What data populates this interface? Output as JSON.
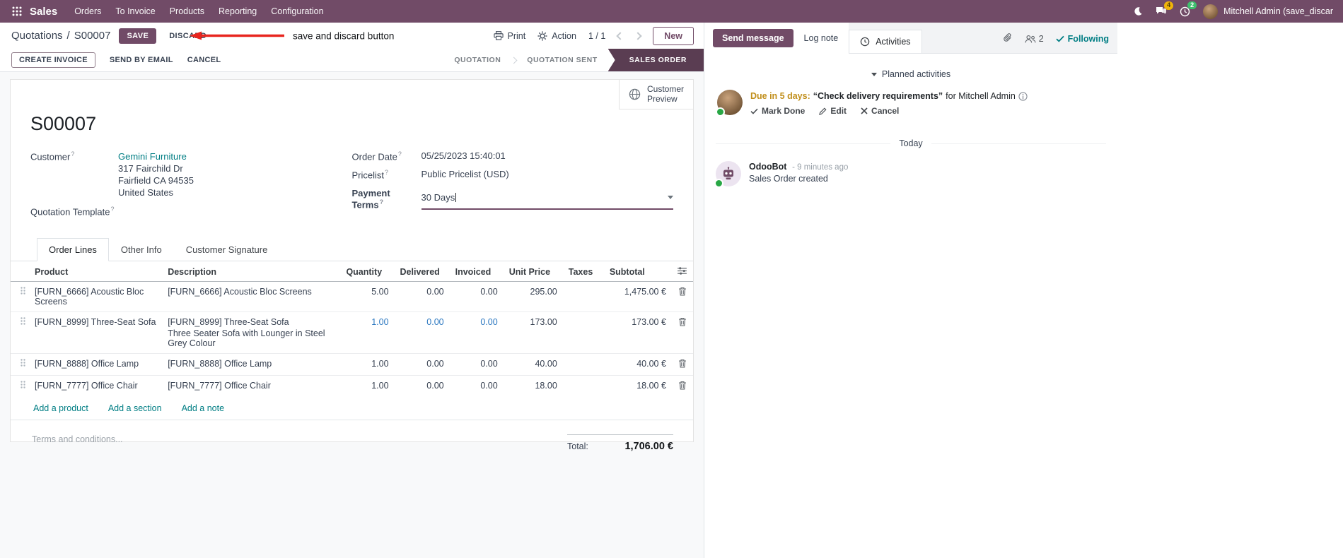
{
  "colors": {
    "brand": "#714B67",
    "link_teal": "#017e84",
    "active_stage": "#5a3d52",
    "edited_value": "#2b77c0",
    "annotation_red": "#e8251f",
    "due_warning": "#c18f1c"
  },
  "ui": {
    "help_marker": "?"
  },
  "nav": {
    "brand": "Sales",
    "items": [
      "Orders",
      "To Invoice",
      "Products",
      "Reporting",
      "Configuration"
    ],
    "systray": {
      "messages_count": "4",
      "activities_count": "2",
      "user_name": "Mitchell Admin (save_discar"
    }
  },
  "control_panel": {
    "breadcrumb_parent": "Quotations",
    "breadcrumb_separator": "/",
    "breadcrumb_current": "S00007",
    "save_label": "SAVE",
    "discard_label": "DISCARD",
    "annotation_text": "save and discard button",
    "print_label": "Print",
    "action_label": "Action",
    "pager": "1 / 1",
    "new_label": "New"
  },
  "statusbar": {
    "buttons": [
      "CREATE INVOICE",
      "SEND BY EMAIL",
      "CANCEL"
    ],
    "stages": [
      "QUOTATION",
      "QUOTATION SENT",
      "SALES ORDER"
    ],
    "active_stage": "SALES ORDER"
  },
  "form": {
    "title": "S00007",
    "customer_preview_line1": "Customer",
    "customer_preview_line2": "Preview",
    "fields": {
      "customer_label": "Customer",
      "customer_name": "Gemini Furniture",
      "address_line1": "317 Fairchild Dr",
      "address_line2": "Fairfield CA 94535",
      "address_line3": "United States",
      "quotation_template_label": "Quotation Template",
      "order_date_label": "Order Date",
      "order_date": "05/25/2023 15:40:01",
      "pricelist_label": "Pricelist",
      "pricelist": "Public Pricelist (USD)",
      "payment_terms_label": "Payment Terms",
      "payment_terms": "30 Days"
    },
    "tabs": [
      "Order Lines",
      "Other Info",
      "Customer Signature"
    ],
    "active_tab": "Order Lines",
    "table": {
      "headers": {
        "product": "Product",
        "description": "Description",
        "quantity": "Quantity",
        "delivered": "Delivered",
        "invoiced": "Invoiced",
        "unit_price": "Unit Price",
        "taxes": "Taxes",
        "subtotal": "Subtotal"
      },
      "rows": [
        {
          "product": "[FURN_6666] Acoustic Bloc Screens",
          "description": "[FURN_6666] Acoustic Bloc Screens",
          "description2": "",
          "quantity": "5.00",
          "delivered": "0.00",
          "invoiced": "0.00",
          "unit_price": "295.00",
          "taxes": "",
          "subtotal": "1,475.00 €"
        },
        {
          "product": "[FURN_8999] Three-Seat Sofa",
          "description": "[FURN_8999] Three-Seat Sofa",
          "description2": "Three Seater Sofa with Lounger in Steel Grey Colour",
          "quantity": "1.00",
          "delivered": "0.00",
          "invoiced": "0.00",
          "unit_price": "173.00",
          "taxes": "",
          "subtotal": "173.00 €"
        },
        {
          "product": "[FURN_8888] Office Lamp",
          "description": "[FURN_8888] Office Lamp",
          "description2": "",
          "quantity": "1.00",
          "delivered": "0.00",
          "invoiced": "0.00",
          "unit_price": "40.00",
          "taxes": "",
          "subtotal": "40.00 €"
        },
        {
          "product": "[FURN_7777] Office Chair",
          "description": "[FURN_7777] Office Chair",
          "description2": "",
          "quantity": "1.00",
          "delivered": "0.00",
          "invoiced": "0.00",
          "unit_price": "18.00",
          "taxes": "",
          "subtotal": "18.00 €"
        }
      ],
      "add_links": [
        "Add a product",
        "Add a section",
        "Add a note"
      ]
    },
    "terms_placeholder": "Terms and conditions...",
    "total_label": "Total:",
    "total_value": "1,706.00 €"
  },
  "chatter": {
    "send_message": "Send message",
    "log_note": "Log note",
    "activities": "Activities",
    "followers_count": "2",
    "following": "Following",
    "planned_header": "Planned activities",
    "activity": {
      "due": "Due in 5 days:",
      "summary": "“Check delivery requirements”",
      "for_user": "for Mitchell Admin",
      "mark_done": "Mark Done",
      "edit": "Edit",
      "cancel": "Cancel"
    },
    "today": "Today",
    "message": {
      "author": "OdooBot",
      "time": "- 9 minutes ago",
      "body": "Sales Order created"
    }
  }
}
